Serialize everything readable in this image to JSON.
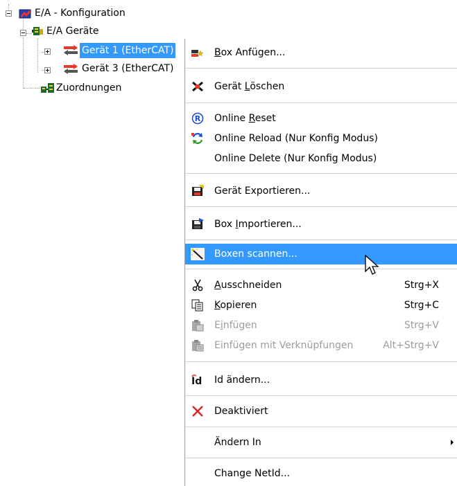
{
  "tree": {
    "root": "E/A - Konfiguration",
    "devices_group": "E/A Geräte",
    "device1": "Gerät 1 (EtherCAT)",
    "device3": "Gerät 3 (EtherCAT)",
    "mappings": "Zuordnungen"
  },
  "menu": {
    "box_anfuegen": {
      "pre": "",
      "acc": "B",
      "post": "ox Anfügen..."
    },
    "geraet_loeschen": {
      "pre": "Gerät ",
      "acc": "L",
      "post": "öschen"
    },
    "online_reset": {
      "pre": "Online ",
      "acc": "R",
      "post": "eset"
    },
    "online_reload": "Online Reload (Nur Konfig Modus)",
    "online_delete": "Online Delete (Nur Konfig Modus)",
    "geraet_exportieren": "Gerät Exportieren...",
    "box_importieren": {
      "pre": "Box ",
      "acc": "I",
      "post": "mportieren..."
    },
    "boxen_scannen": "Boxen scannen...",
    "ausschneiden": {
      "pre": "",
      "acc": "A",
      "post": "usschneiden",
      "shortcut": "Strg+X"
    },
    "kopieren": {
      "pre": "",
      "acc": "K",
      "post": "opieren",
      "shortcut": "Strg+C"
    },
    "einfuegen": {
      "pre": "E",
      "acc": "i",
      "post": "nfügen",
      "shortcut": "Strg+V"
    },
    "einfuegen_mit": {
      "label": "Einfügen mit Verknüpfungen",
      "shortcut": "Alt+Strg+V"
    },
    "id_aendern": "Id ändern...",
    "deaktiviert": "Deaktiviert",
    "aendern_in": "Ändern In",
    "change_netid": "Change NetId..."
  },
  "colors": {
    "selection": "#3399ff",
    "disabled_text": "#9c9c9c"
  }
}
